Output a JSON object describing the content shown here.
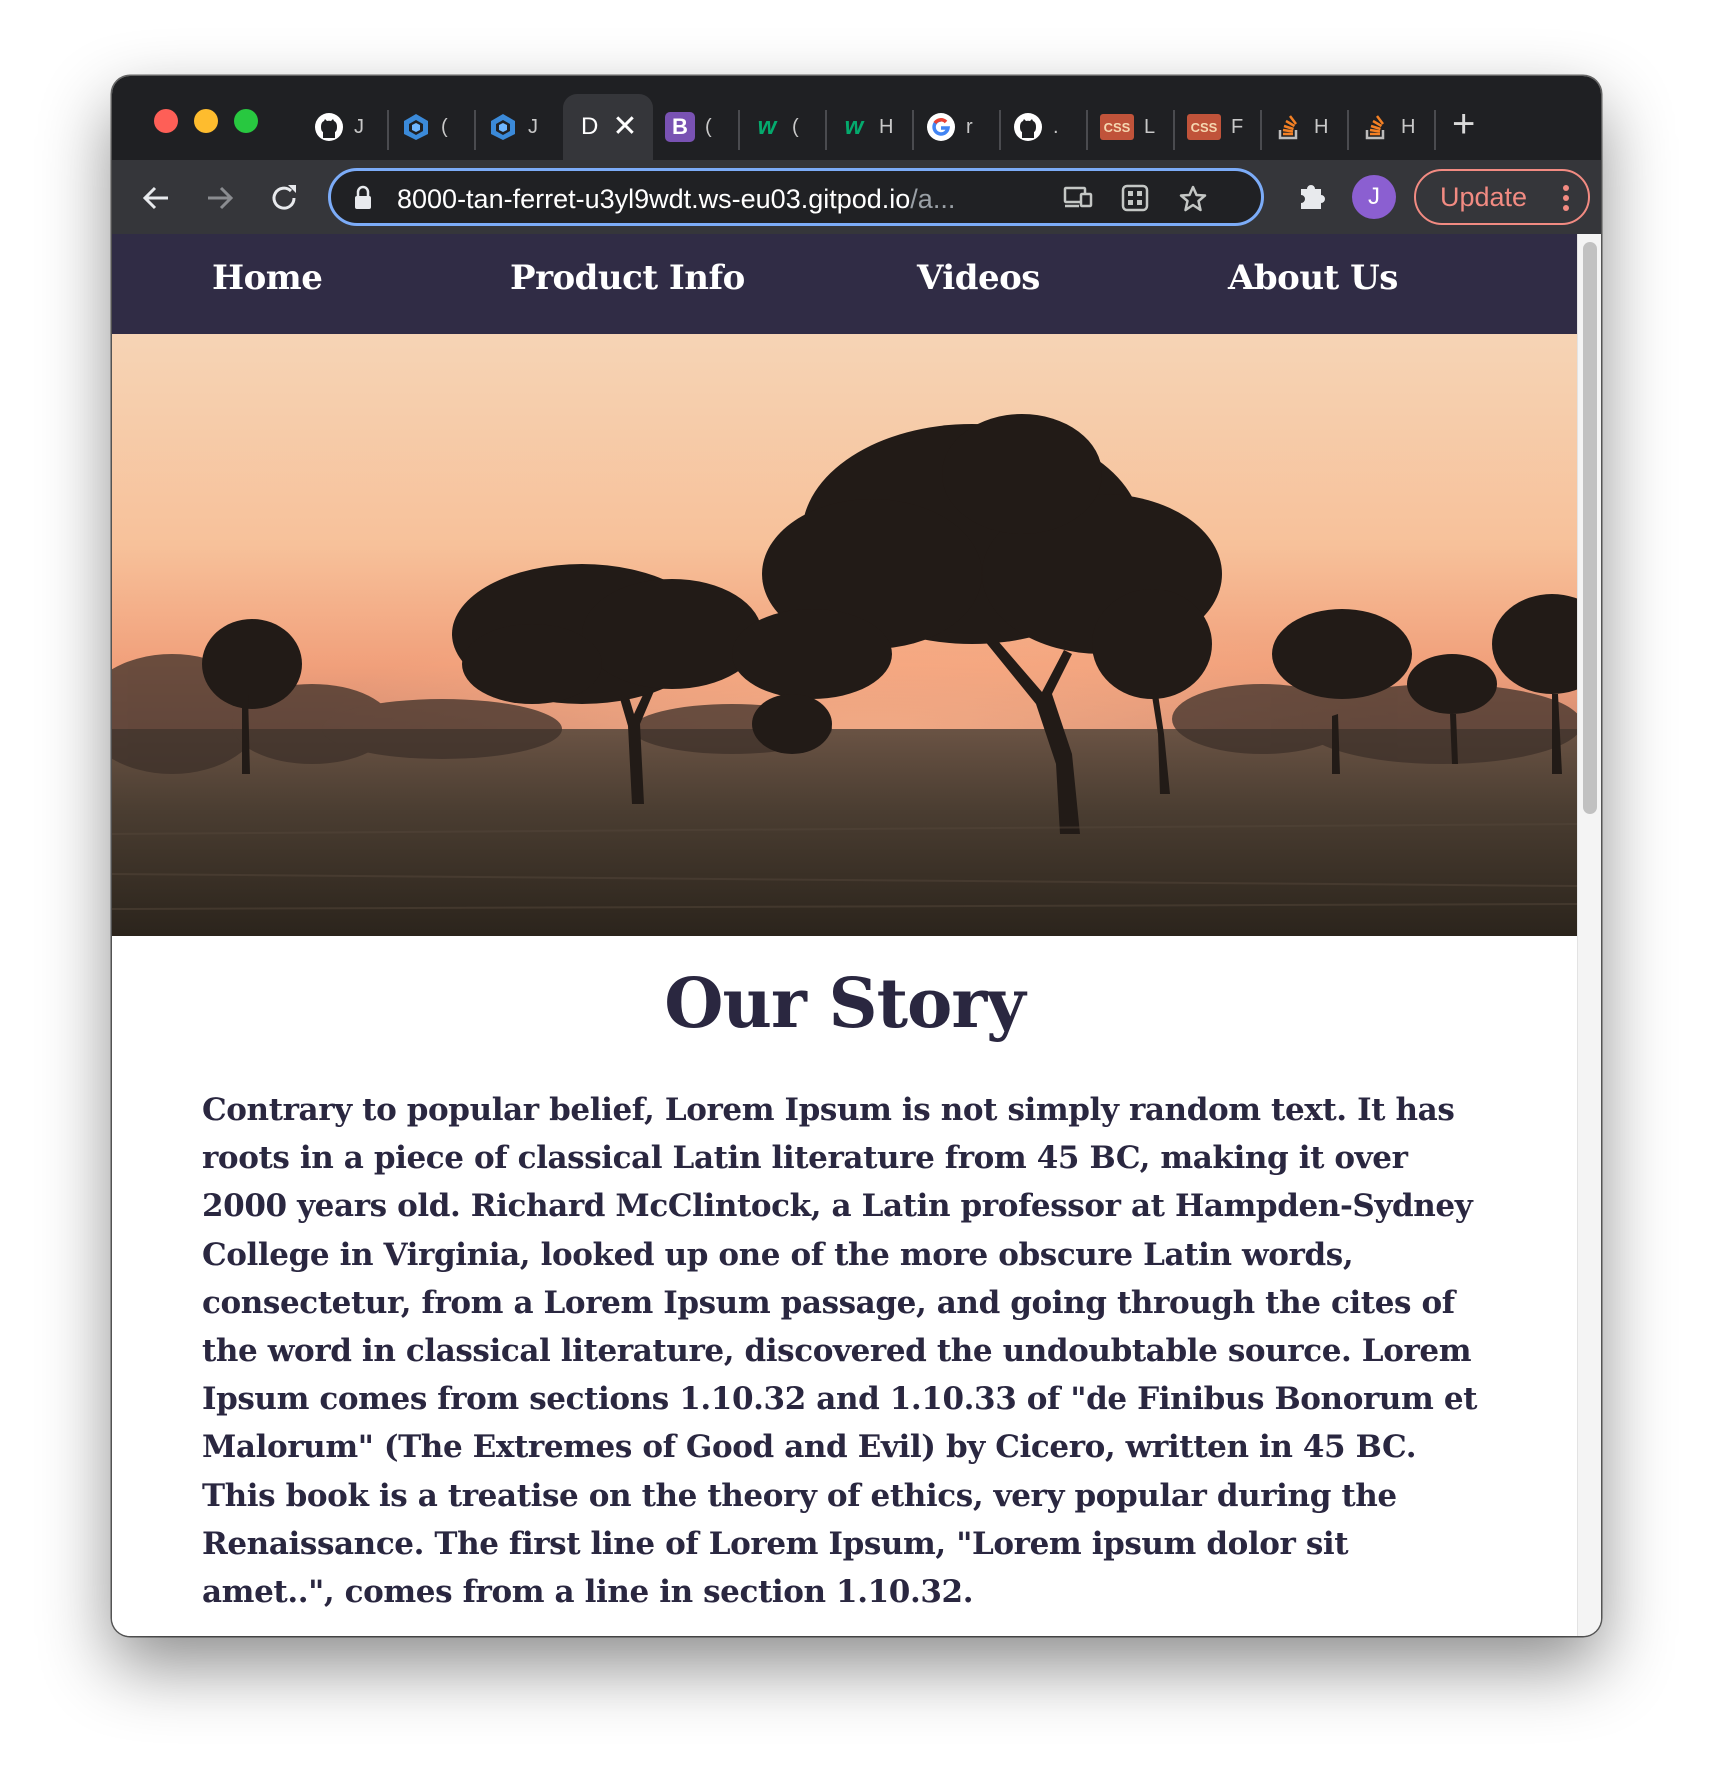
{
  "browser": {
    "tabs": [
      {
        "icon": "github-icon",
        "title": "J",
        "bg": "#1f2023"
      },
      {
        "icon": "cube-icon",
        "title": "(",
        "bg": "#1f2023"
      },
      {
        "icon": "cube-icon",
        "title": "J",
        "bg": "#1f2023"
      },
      {
        "icon": "",
        "title": "D",
        "active": true
      },
      {
        "icon": "bootstrap-icon",
        "title": "(",
        "bg": "#7952b3"
      },
      {
        "icon": "w3schools-icon",
        "title": "(",
        "bg": "#1f2023"
      },
      {
        "icon": "w3schools-icon",
        "title": "H",
        "bg": "#1f2023"
      },
      {
        "icon": "google-icon",
        "title": "r",
        "bg": "#1f2023"
      },
      {
        "icon": "github-icon",
        "title": ".",
        "bg": "#1f2023"
      },
      {
        "icon": "css-icon",
        "title": "L",
        "bg": "#1f2023"
      },
      {
        "icon": "css-icon",
        "title": "F",
        "bg": "#1f2023"
      },
      {
        "icon": "stackoverflow-icon",
        "title": "H",
        "bg": "#1f2023"
      },
      {
        "icon": "stackoverflow-icon",
        "title": "H",
        "bg": "#1f2023"
      }
    ],
    "active_tab_close": "✕",
    "new_tab": "+",
    "url_host": "8000-tan-ferret-u3yl9wdt.ws-eu03.gitpod.io",
    "url_rest": "/a...",
    "avatar_letter": "J",
    "update_label": "Update"
  },
  "site": {
    "nav": [
      "Home",
      "Product Info",
      "Videos",
      "About Us"
    ],
    "title": "Our Story",
    "body": "Contrary to popular belief, Lorem Ipsum is not simply random text. It has roots in a piece of classical Latin literature from 45 BC, making it over 2000 years old. Richard McClintock, a Latin professor at Hampden-Sydney College in Virginia, looked up one of the more obscure Latin words, consectetur, from a Lorem Ipsum passage, and going through the cites of the word in classical literature, discovered the undoubtable source. Lorem Ipsum comes from sections 1.10.32 and 1.10.33 of \"de Finibus Bonorum et Malorum\" (The Extremes of Good and Evil) by Cicero, written in 45 BC. This book is a treatise on the theory of ethics, very popular during the Renaissance. The first line of Lorem Ipsum, \"Lorem ipsum dolor sit amet..\", comes from a line in section 1.10.32."
  },
  "colors": {
    "nav_bg": "#302c45",
    "text": "#2a2740",
    "update_accent": "#f28b82",
    "omnibox_focus": "#7cacf8"
  }
}
